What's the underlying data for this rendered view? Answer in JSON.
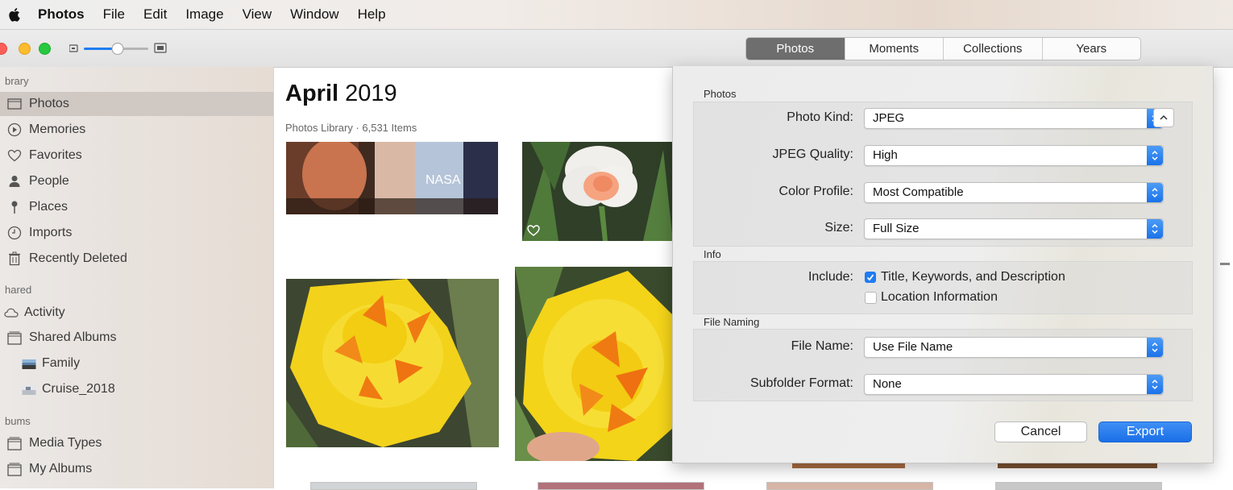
{
  "menubar": {
    "app": "Photos",
    "items": [
      "File",
      "Edit",
      "Image",
      "View",
      "Window",
      "Help"
    ]
  },
  "toolbar": {
    "view_tabs": [
      "Photos",
      "Moments",
      "Collections",
      "Years"
    ],
    "selected_tab": "Photos"
  },
  "sidebar": {
    "library_header": "brary",
    "library_items": [
      {
        "label": "Photos",
        "icon": "photos-icon",
        "selected": true
      },
      {
        "label": "Memories",
        "icon": "memories-icon"
      },
      {
        "label": "Favorites",
        "icon": "heart-icon"
      },
      {
        "label": "People",
        "icon": "person-icon"
      },
      {
        "label": "Places",
        "icon": "pin-icon"
      },
      {
        "label": "Imports",
        "icon": "clock-icon"
      },
      {
        "label": "Recently Deleted",
        "icon": "trash-icon"
      }
    ],
    "shared_header": "hared",
    "shared_items": [
      {
        "label": "Activity",
        "icon": "cloud-icon"
      },
      {
        "label": "Shared Albums",
        "icon": "album-icon"
      },
      {
        "label": "Family",
        "icon": "album-thumb-icon"
      },
      {
        "label": "Cruise_2018",
        "icon": "album-thumb-icon"
      }
    ],
    "albums_header": "bums",
    "album_items": [
      {
        "label": "Media Types",
        "icon": "album-icon"
      },
      {
        "label": "My Albums",
        "icon": "album-icon"
      }
    ]
  },
  "main": {
    "month": "April",
    "year": "2019",
    "subtitle": "Photos Library · 6,531 Items"
  },
  "export_dialog": {
    "photos_section": "Photos",
    "photo_kind_label": "Photo Kind:",
    "photo_kind_value": "JPEG",
    "jpeg_quality_label": "JPEG Quality:",
    "jpeg_quality_value": "High",
    "color_profile_label": "Color Profile:",
    "color_profile_value": "Most Compatible",
    "size_label": "Size:",
    "size_value": "Full Size",
    "info_section": "Info",
    "include_label": "Include:",
    "include_title_keywords": "Title, Keywords, and Description",
    "include_title_keywords_checked": true,
    "include_location": "Location Information",
    "include_location_checked": false,
    "file_naming_section": "File Naming",
    "file_name_label": "File Name:",
    "file_name_value": "Use File Name",
    "subfolder_label": "Subfolder Format:",
    "subfolder_value": "None",
    "cancel": "Cancel",
    "export": "Export"
  },
  "colors": {
    "accent": "#1f7cf2",
    "selected_segment": "#6e6e6e",
    "daffodil_yellow": "#f2d21b",
    "daffodil_orange": "#f07a12"
  }
}
